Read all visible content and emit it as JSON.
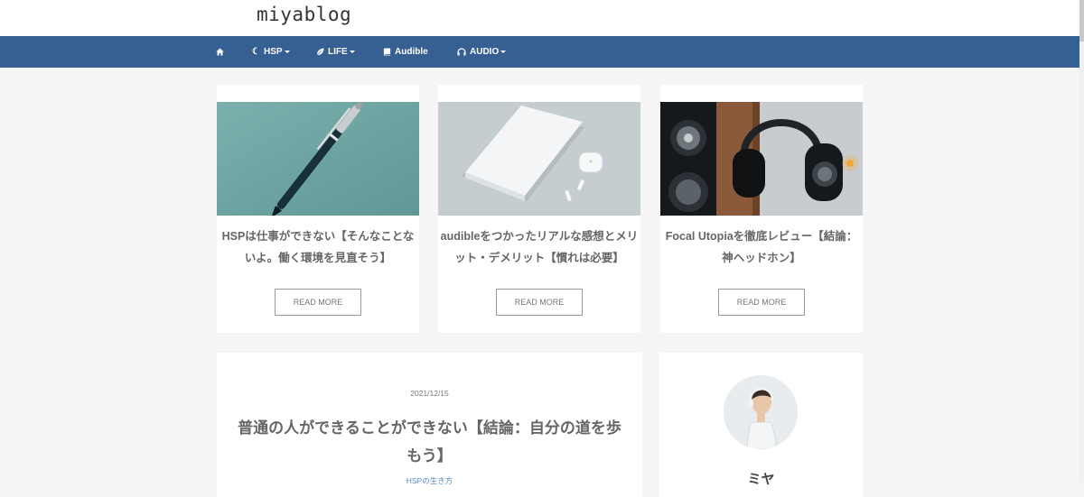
{
  "site": {
    "title": "miyablog"
  },
  "nav": {
    "items": [
      {
        "icon": "home-icon",
        "label": ""
      },
      {
        "icon": "moon-icon",
        "label": "HSP",
        "dropdown": true
      },
      {
        "icon": "leaf-icon",
        "label": "LIFE",
        "dropdown": true
      },
      {
        "icon": "book-icon",
        "label": "Audible",
        "dropdown": false
      },
      {
        "icon": "headphones-icon",
        "label": "AUDIO",
        "dropdown": true
      }
    ]
  },
  "cards": [
    {
      "title": "HSPは仕事ができない【そんなことないよ。働く環境を見直そう】",
      "button": "READ MORE",
      "image": "pen-on-teal-background"
    },
    {
      "title": "audibleをつかったリアルな感想とメリット・デメリット【慣れは必要】",
      "button": "READ MORE",
      "image": "notebook-and-earbuds"
    },
    {
      "title": "Focal Utopiaを徹底レビュー【結論：神ヘッドホン】",
      "button": "READ MORE",
      "image": "headphones-and-speakers"
    }
  ],
  "article": {
    "date": "2021/12/15",
    "title": "普通の人ができることができない【結論：自分の道を歩もう】",
    "category": "HSPの生き方"
  },
  "profile": {
    "name": "ミヤ",
    "image": "avatar-person-with-headphones"
  },
  "colors": {
    "nav_bg": "#366091",
    "page_bg": "#f5f5f5",
    "link": "#5a8ac6"
  }
}
